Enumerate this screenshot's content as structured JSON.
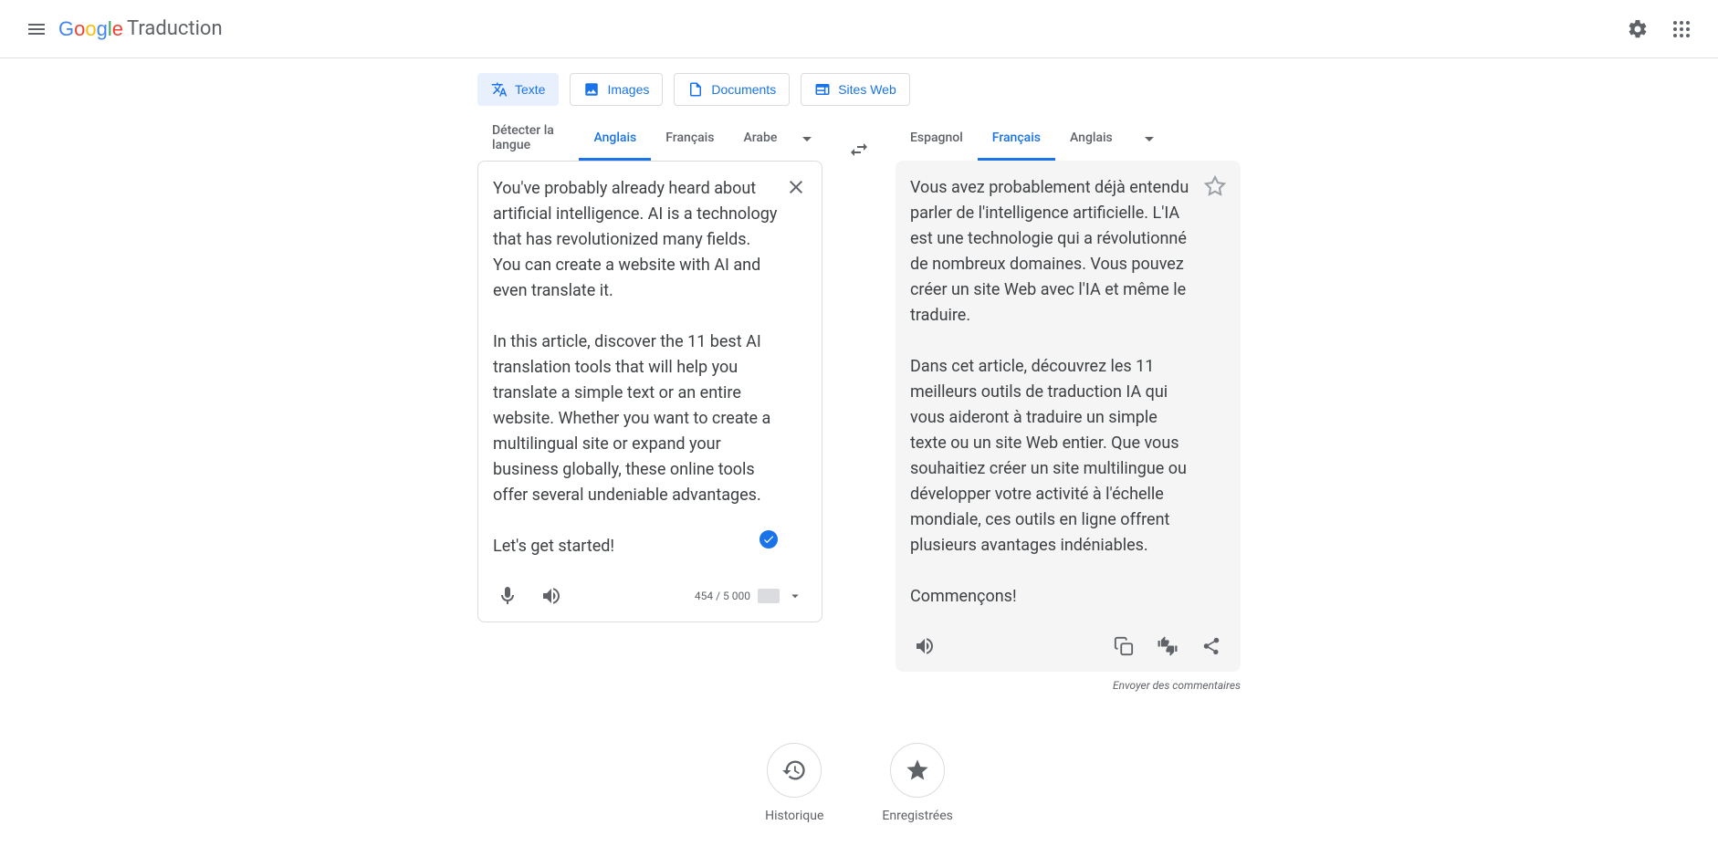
{
  "header": {
    "product_name": "Traduction"
  },
  "modes": {
    "text": "Texte",
    "images": "Images",
    "documents": "Documents",
    "websites": "Sites Web"
  },
  "source_langs": {
    "detect": "Détecter la langue",
    "english": "Anglais",
    "french": "Français",
    "arabic": "Arabe"
  },
  "target_langs": {
    "spanish": "Espagnol",
    "french": "Français",
    "english": "Anglais"
  },
  "source_text": "You've probably already heard about artificial intelligence. AI is a technology that has revolutionized many fields. You can create a website with AI and even translate it.\n\nIn this article, discover the 11 best AI translation tools that will help you translate a simple text or an entire website. Whether you want to create a multilingual site or expand your business globally, these online tools offer several undeniable advantages.\n\nLet's get started!",
  "target_text": "Vous avez probablement déjà entendu parler de l'intelligence artificielle. L'IA est une technologie qui a révolutionné de nombreux domaines. Vous pouvez créer un site Web avec l'IA et même le traduire.\n\nDans cet article, découvrez les 11 meilleurs outils de traduction IA qui vous aideront à traduire un simple texte ou un site Web entier. Que vous souhaitiez créer un site multilingue ou développer votre activité à l'échelle mondiale, ces outils en ligne offrent plusieurs avantages indéniables.\n\nCommençons!",
  "char_count": "454 / 5 000",
  "feedback_link": "Envoyer des commentaires",
  "bottom": {
    "history": "Historique",
    "saved": "Enregistrées"
  }
}
